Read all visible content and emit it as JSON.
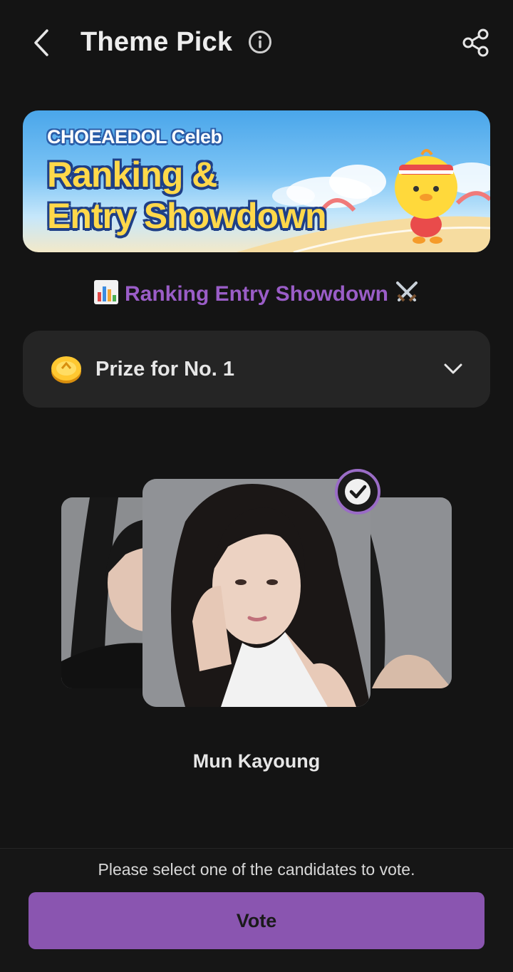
{
  "header": {
    "title": "Theme Pick",
    "back_icon": "chevron-left-icon",
    "info_icon": "info-circle-icon",
    "share_icon": "share-icon"
  },
  "banner": {
    "brand": "CHOEAEDOL Celeb",
    "headline_line1": "Ranking &",
    "headline_line2": "Entry Showdown"
  },
  "event": {
    "title": "Ranking Entry Showdown",
    "leading_emoji": "bar-chart-icon",
    "trailing_emoji": "crossed-swords-icon"
  },
  "prize": {
    "label": "Prize for No. 1",
    "icon": "coin-icon",
    "expand_icon": "chevron-down-icon"
  },
  "candidates": {
    "selected_name": "Mun Kayoung"
  },
  "footer": {
    "hint": "Please select one of the candidates to vote.",
    "vote_label": "Vote"
  },
  "colors": {
    "background": "#141414",
    "accent": "#8a55b0",
    "event_title": "#9a5dc7",
    "card_bg": "#252525"
  }
}
